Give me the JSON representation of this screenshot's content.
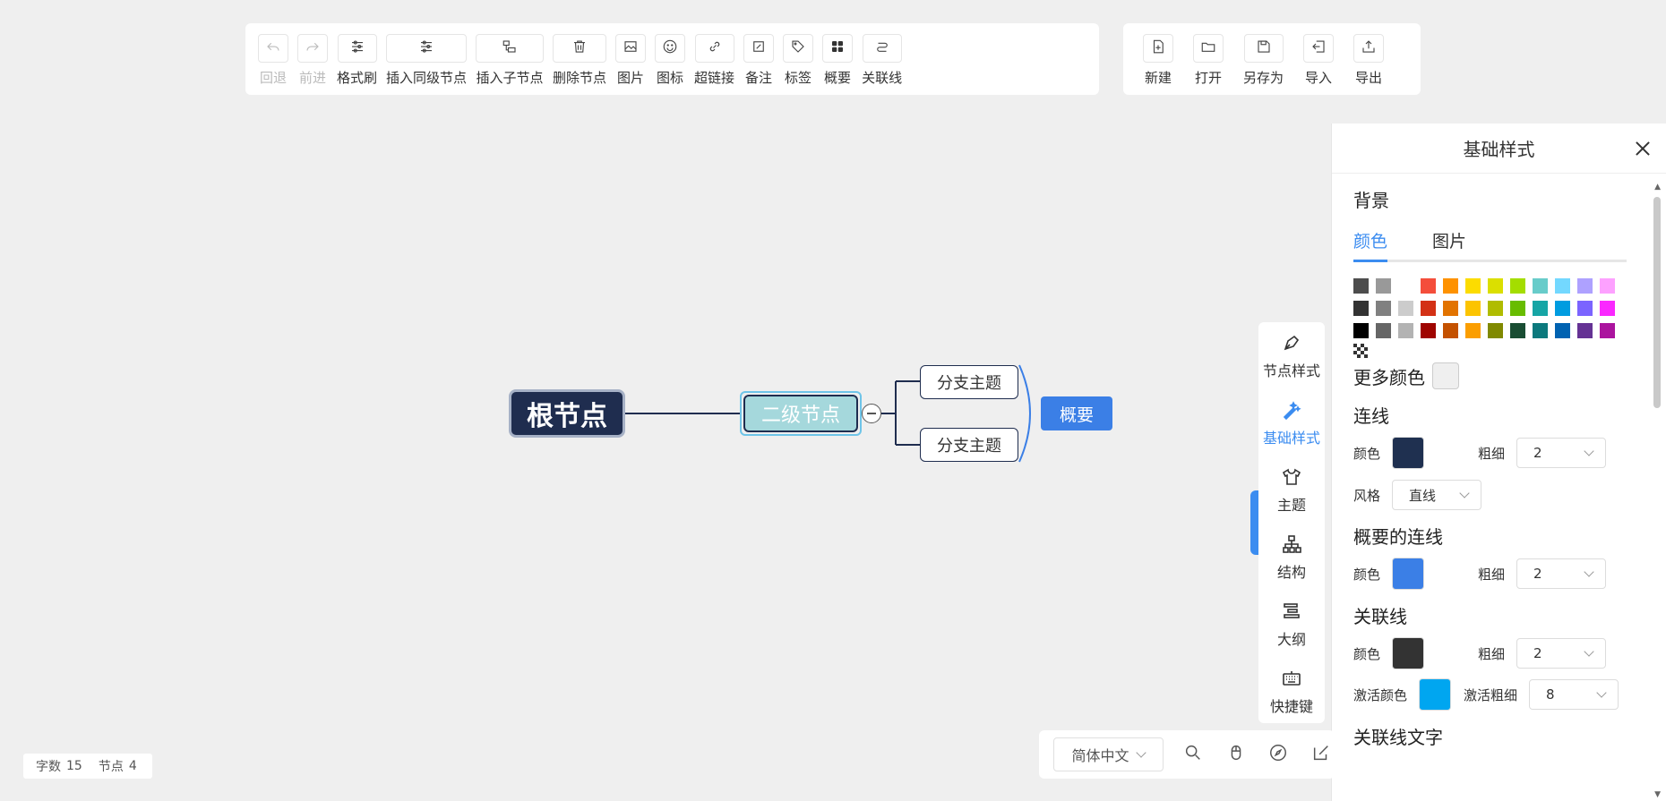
{
  "toolbar_left": [
    {
      "label": "回退",
      "icon": "undo-icon",
      "disabled": true
    },
    {
      "label": "前进",
      "icon": "redo-icon",
      "disabled": true
    },
    {
      "label": "格式刷",
      "icon": "format-brush-icon",
      "disabled": false
    },
    {
      "label": "插入同级节点",
      "icon": "insert-sibling-icon",
      "disabled": false
    },
    {
      "label": "插入子节点",
      "icon": "insert-child-icon",
      "disabled": false
    },
    {
      "label": "删除节点",
      "icon": "delete-icon",
      "disabled": false
    },
    {
      "label": "图片",
      "icon": "image-icon",
      "disabled": false
    },
    {
      "label": "图标",
      "icon": "emoji-icon",
      "disabled": false
    },
    {
      "label": "超链接",
      "icon": "link-icon",
      "disabled": false
    },
    {
      "label": "备注",
      "icon": "note-icon",
      "disabled": false
    },
    {
      "label": "标签",
      "icon": "tag-icon",
      "disabled": false
    },
    {
      "label": "概要",
      "icon": "summary-icon",
      "disabled": false
    },
    {
      "label": "关联线",
      "icon": "association-line-icon",
      "disabled": false
    }
  ],
  "toolbar_right": [
    {
      "label": "新建",
      "icon": "new-file-icon"
    },
    {
      "label": "打开",
      "icon": "open-folder-icon"
    },
    {
      "label": "另存为",
      "icon": "save-as-icon"
    },
    {
      "label": "导入",
      "icon": "import-icon"
    },
    {
      "label": "导出",
      "icon": "export-icon"
    }
  ],
  "mindmap": {
    "root": "根节点",
    "second": "二级节点",
    "branches": [
      "分支主题",
      "分支主题"
    ],
    "summary": "概要"
  },
  "side_tabs": [
    {
      "label": "节点样式",
      "icon": "node-style-icon",
      "active": false
    },
    {
      "label": "基础样式",
      "icon": "base-style-icon",
      "active": true
    },
    {
      "label": "主题",
      "icon": "theme-shirt-icon",
      "active": false
    },
    {
      "label": "结构",
      "icon": "structure-icon",
      "active": false
    },
    {
      "label": "大纲",
      "icon": "outline-icon",
      "active": false
    },
    {
      "label": "快捷键",
      "icon": "keyboard-icon",
      "active": false
    }
  ],
  "panel": {
    "title": "基础样式",
    "background": {
      "title": "背景",
      "tabs": [
        "颜色",
        "图片"
      ],
      "active_tab": "颜色",
      "palette": [
        "#4d4d4d",
        "#999999",
        "#ffffff",
        "#f44e3b",
        "#fe9200",
        "#fcdc00",
        "#dbdf00",
        "#a4dd00",
        "#68ccca",
        "#73d8ff",
        "#aea1ff",
        "#fda1ff",
        "#333333",
        "#808080",
        "#cccccc",
        "#d33115",
        "#e27300",
        "#fcc400",
        "#b0bc00",
        "#68bc00",
        "#16a5a5",
        "#009ce0",
        "#7b64ff",
        "#fa28ff",
        "#000000",
        "#666666",
        "#b3b3b3",
        "#9f0500",
        "#c45100",
        "#fb9e00",
        "#808900",
        "#194d33",
        "#0c797d",
        "#0062b1",
        "#653294",
        "#ab149e"
      ],
      "more_colors": "更多颜色"
    },
    "line": {
      "title": "连线",
      "color_label": "颜色",
      "color": "#1f3050",
      "width_label": "粗细",
      "width": "2",
      "style_label": "风格",
      "style": "直线"
    },
    "summary_line": {
      "title": "概要的连线",
      "color_label": "颜色",
      "color": "#3b7fe6",
      "width_label": "粗细",
      "width": "2"
    },
    "association_line": {
      "title": "关联线",
      "color_label": "颜色",
      "color": "#333333",
      "width_label": "粗细",
      "width": "2",
      "active_color_label": "激活颜色",
      "active_color": "#00a6f0",
      "active_width_label": "激活粗细",
      "active_width": "8"
    },
    "association_text_title": "关联线文字"
  },
  "bottom": {
    "language": "简体中文",
    "icons": [
      "search-icon",
      "mouse-icon",
      "compass-icon",
      "edit-icon"
    ]
  },
  "stats": {
    "word_label": "字数",
    "word_count": "15",
    "node_label": "节点",
    "node_count": "4"
  }
}
